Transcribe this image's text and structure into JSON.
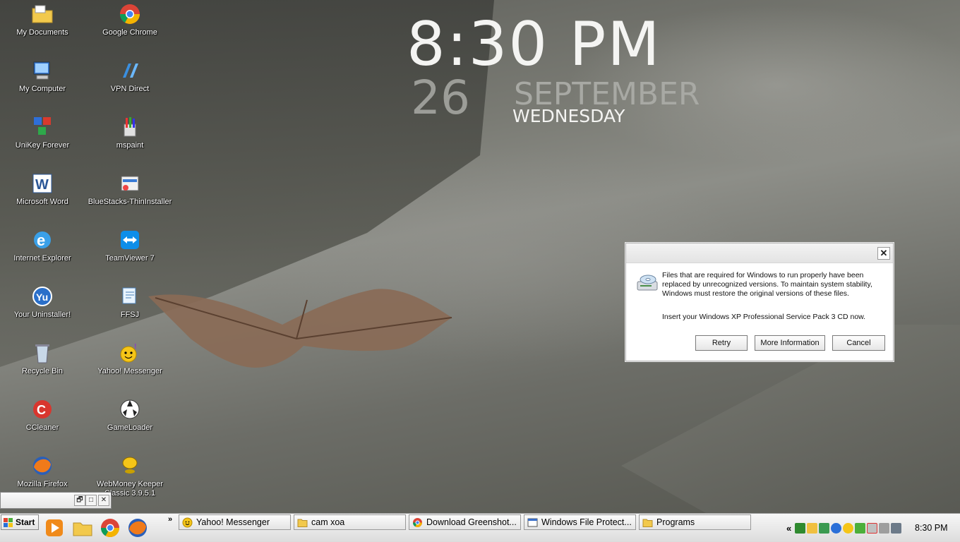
{
  "clock": {
    "time": "8:30 PM",
    "day": "26",
    "month": "SEPTEMBER",
    "weekday": "WEDNESDAY"
  },
  "desktop_icons": [
    {
      "label": "My Documents",
      "icon": "folder-documents-icon"
    },
    {
      "label": "Google Chrome",
      "icon": "chrome-icon"
    },
    {
      "label": "My Computer",
      "icon": "computer-icon"
    },
    {
      "label": "VPN Direct",
      "icon": "vpn-icon"
    },
    {
      "label": "UniKey Forever",
      "icon": "unikey-icon"
    },
    {
      "label": "mspaint",
      "icon": "paint-icon"
    },
    {
      "label": "Microsoft Word",
      "icon": "word-icon"
    },
    {
      "label": "BlueStacks-ThinInstaller",
      "icon": "installer-icon"
    },
    {
      "label": "Internet Explorer",
      "icon": "ie-icon"
    },
    {
      "label": "TeamViewer 7",
      "icon": "teamviewer-icon"
    },
    {
      "label": "Your Uninstaller!",
      "icon": "uninstaller-icon"
    },
    {
      "label": "FFSJ",
      "icon": "ffsj-icon"
    },
    {
      "label": "Recycle Bin",
      "icon": "recycle-bin-icon"
    },
    {
      "label": "Yahoo! Messenger",
      "icon": "yahoo-icon"
    },
    {
      "label": "CCleaner",
      "icon": "ccleaner-icon"
    },
    {
      "label": "GameLoader",
      "icon": "gameloader-icon"
    },
    {
      "label": "Mozilla Firefox",
      "icon": "firefox-icon"
    },
    {
      "label": "WebMoney Keeper Classic 3.9.5.1",
      "icon": "webmoney-icon"
    }
  ],
  "dialog": {
    "message": "Files that are required for Windows to run properly have been replaced by unrecognized versions.  To maintain system stability, Windows must restore the original versions of these files.",
    "instruction": "Insert your Windows XP Professional Service Pack 3 CD now.",
    "close_label": "✕",
    "buttons": {
      "retry": "Retry",
      "more_info": "More Information",
      "cancel": "Cancel"
    }
  },
  "mini_window": {
    "restore": "🗗",
    "maximize": "□",
    "close": "✕"
  },
  "taskbar": {
    "start_label": "Start",
    "overflow_chevron": "»",
    "tasks": [
      {
        "label": "Yahoo! Messenger",
        "icon": "yahoo-icon"
      },
      {
        "label": "cam xoa",
        "icon": "folder-icon"
      },
      {
        "label": "Download Greenshot...",
        "icon": "chrome-icon"
      },
      {
        "label": "Windows File Protect...",
        "icon": "window-icon"
      },
      {
        "label": "Programs",
        "icon": "folder-icon"
      }
    ],
    "tray_chevron": "«",
    "tray_time": "8:30 PM"
  },
  "colors": {
    "dialog_bg": "#ffffff",
    "taskbar_bg": "#e8e8e8",
    "clock_text": "#f4f4f2"
  }
}
